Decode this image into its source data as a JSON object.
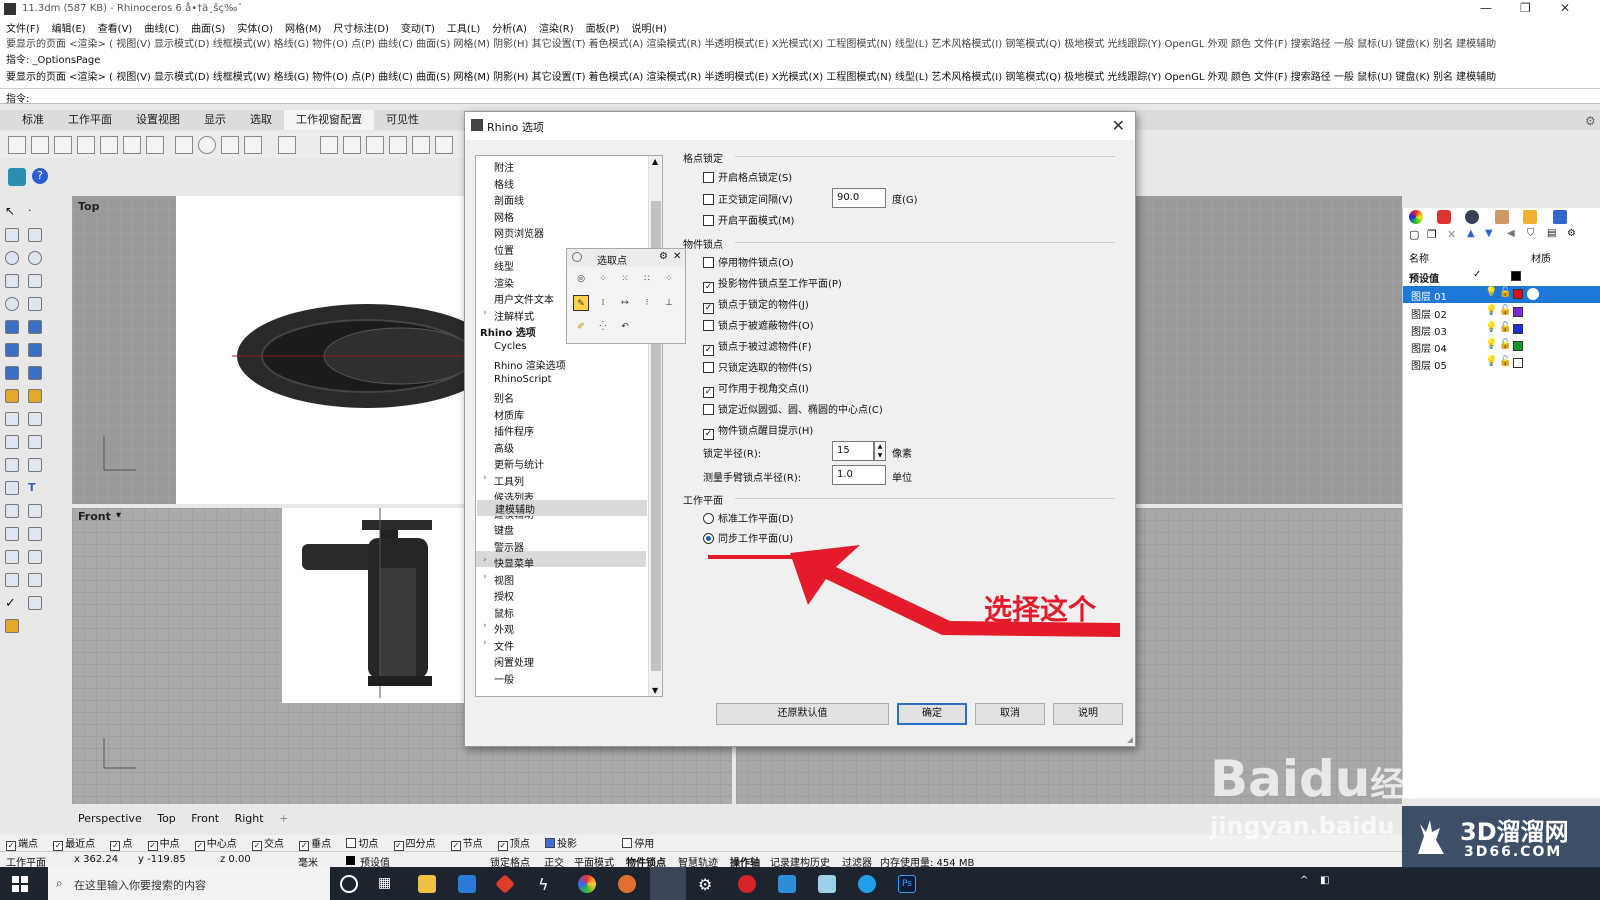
{
  "window": {
    "title": "11.3dm (587 KB) - Rhinoceros 6 å•†ä¸šç‰ˆ"
  },
  "menu": [
    "文件(F)",
    "编辑(E)",
    "查看(V)",
    "曲线(C)",
    "曲面(S)",
    "实体(O)",
    "网格(M)",
    "尺寸标注(D)",
    "变动(T)",
    "工具(L)",
    "分析(A)",
    "渲染(R)",
    "面板(P)",
    "说明(H)"
  ],
  "command_history": {
    "line1": "要显示的页面 <渲染> ( 视图(V) 显示模式(D) 线框模式(W) 格线(G) 物件(O) 点(P) 曲线(C) 曲面(S) 网格(M) 阴影(H) 其它设置(T) 着色模式(A) 渲染模式(R) 半透明模式(E) X光模式(X) 工程图模式(N) 线型(L) 艺术风格模式(I) 钢笔模式(Q) 极地模式 光线跟踪(Y) OpenGL 外观 颜色 文件(F) 搜索路径 一般 鼠标(U) 键盘(K) 别名 建模辅助",
    "line2": "指令: _OptionsPage",
    "line3": "要显示的页面 <渲染> ( 视图(V) 显示模式(D) 线框模式(W) 格线(G) 物件(O) 点(P) 曲线(C) 曲面(S) 网格(M) 阴影(H) 其它设置(T) 着色模式(A) 渲染模式(R) 半透明模式(E) X光模式(X) 工程图模式(N) 线型(L) 艺术风格模式(I) 钢笔模式(Q) 极地模式 光线跟踪(Y) OpenGL 外观 颜色 文件(F) 搜索路径 一般 鼠标(U) 键盘(K) 别名 建模辅助"
  },
  "command_prompt": "指令:",
  "toolbar_tabs": [
    "标准",
    "工作平面",
    "设置视图",
    "显示",
    "选取",
    "工作视窗配置",
    "可见性"
  ],
  "viewports": {
    "top": "Top",
    "front": "Front"
  },
  "bottom_tabs": [
    "Perspective",
    "Top",
    "Front",
    "Right",
    "+"
  ],
  "dialog": {
    "title": "Rhino 选项",
    "tree": [
      {
        "label": "附注",
        "kind": "item"
      },
      {
        "label": "格线",
        "kind": "item"
      },
      {
        "label": "剖面线",
        "kind": "item"
      },
      {
        "label": "网格",
        "kind": "item"
      },
      {
        "label": "网页浏览器",
        "kind": "item"
      },
      {
        "label": "位置",
        "kind": "item"
      },
      {
        "label": "线型",
        "kind": "item"
      },
      {
        "label": "渲染",
        "kind": "item"
      },
      {
        "label": "用户文件文本",
        "kind": "item"
      },
      {
        "label": "注解样式",
        "kind": "expand"
      },
      {
        "label": "Rhino 选项",
        "kind": "top"
      },
      {
        "label": "Cycles",
        "kind": "item"
      },
      {
        "label": "Rhino 渲染选项",
        "kind": "item"
      },
      {
        "label": "RhinoScript",
        "kind": "item"
      },
      {
        "label": "别名",
        "kind": "item"
      },
      {
        "label": "材质库",
        "kind": "item"
      },
      {
        "label": "插件程序",
        "kind": "item"
      },
      {
        "label": "高级",
        "kind": "item"
      },
      {
        "label": "更新与统计",
        "kind": "item"
      },
      {
        "label": "工具列",
        "kind": "expand"
      },
      {
        "label": "候选列表",
        "kind": "item"
      },
      {
        "label": "建模辅助",
        "kind": "expand-selected"
      },
      {
        "label": "键盘",
        "kind": "item"
      },
      {
        "label": "警示器",
        "kind": "item"
      },
      {
        "label": "快显菜单",
        "kind": "expand"
      },
      {
        "label": "视图",
        "kind": "expand"
      },
      {
        "label": "授权",
        "kind": "item"
      },
      {
        "label": "鼠标",
        "kind": "item"
      },
      {
        "label": "外观",
        "kind": "expand"
      },
      {
        "label": "文件",
        "kind": "expand"
      },
      {
        "label": "闲置处理",
        "kind": "item"
      },
      {
        "label": "一般",
        "kind": "item"
      }
    ],
    "grid_snap_group": "格点锁定",
    "grid_snap": [
      {
        "label": "开启格点锁定(S)",
        "checked": false
      },
      {
        "label": "正交锁定间隔(V)",
        "checked": false
      },
      {
        "label": "开启平面模式(M)",
        "checked": false
      }
    ],
    "ortho_value": "90.0",
    "ortho_unit": "度(G)",
    "osnap_group": "物件锁点",
    "osnap": [
      {
        "label": "停用物件锁点(O)",
        "checked": false
      },
      {
        "label": "投影物件锁点至工作平面(P)",
        "checked": true
      },
      {
        "label": "锁点于锁定的物件(J)",
        "checked": true
      },
      {
        "label": "锁点于被遮蔽物件(O)",
        "checked": false
      },
      {
        "label": "锁点于被过滤物件(F)",
        "checked": true
      },
      {
        "label": "只锁定选取的物件(S)",
        "checked": false
      },
      {
        "label": "可作用于视角交点(I)",
        "checked": true
      },
      {
        "label": "锁定近似圆弧、圆、椭圆的中心点(C)",
        "checked": false
      },
      {
        "label": "物件锁点醒目提示(H)",
        "checked": true
      }
    ],
    "snap_radius_label": "锁定半径(R):",
    "snap_radius": "15",
    "snap_radius_unit": "像素",
    "tape_radius_label": "测量手臂锁点半径(R):",
    "tape_radius": "1.0",
    "tape_radius_unit": "单位",
    "cplane_group": "工作平面",
    "cplane": [
      {
        "label": "标准工作平面(D)",
        "checked": false
      },
      {
        "label": "同步工作平面(U)",
        "checked": true
      }
    ],
    "buttons": {
      "restore": "还原默认值",
      "ok": "确定",
      "cancel": "取消",
      "help": "说明"
    }
  },
  "popup": {
    "title": "选取点"
  },
  "annotation": "选择这个",
  "layers": {
    "header_name": "名称",
    "header_material": "材质",
    "rows": [
      {
        "name": "预设值",
        "color": "#000000",
        "current": true
      },
      {
        "name": "图层 01",
        "color": "#e01010",
        "selected": true
      },
      {
        "name": "图层 02",
        "color": "#7a2bd6"
      },
      {
        "name": "图层 03",
        "color": "#1a2fd0"
      },
      {
        "name": "图层 04",
        "color": "#129a2a"
      },
      {
        "name": "图层 05",
        "color": "#ffffff"
      }
    ]
  },
  "osnap_bar": [
    {
      "label": "端点",
      "checked": true
    },
    {
      "label": "最近点",
      "checked": true
    },
    {
      "label": "点",
      "checked": true
    },
    {
      "label": "中点",
      "checked": true
    },
    {
      "label": "中心点",
      "checked": true
    },
    {
      "label": "交点",
      "checked": true
    },
    {
      "label": "垂点",
      "checked": true
    },
    {
      "label": "切点",
      "checked": false
    },
    {
      "label": "四分点",
      "checked": true
    },
    {
      "label": "节点",
      "checked": true
    },
    {
      "label": "顶点",
      "checked": true
    },
    {
      "label": "投影",
      "checked": true
    },
    {
      "label": "停用",
      "checked": false
    }
  ],
  "status": {
    "plane": "工作平面",
    "x": "x 362.24",
    "y": "y -119.85",
    "z": "z 0.00",
    "unit": "毫米",
    "layer": "预设值",
    "toggles": [
      "锁定格点",
      "正交",
      "平面模式",
      "物件锁点",
      "智慧轨迹",
      "操作轴",
      "记录建构历史",
      "过滤器"
    ],
    "memory": "内存使用量: 454 MB"
  },
  "taskbar": {
    "search_placeholder": "在这里输入你要搜索的内容"
  },
  "watermarks": {
    "baidu": "Bai",
    "du": "du",
    "jingyan": "经验",
    "site": "jingyan.baidu",
    "brand": "3D溜溜网",
    "brand_url": "3D66.COM"
  }
}
